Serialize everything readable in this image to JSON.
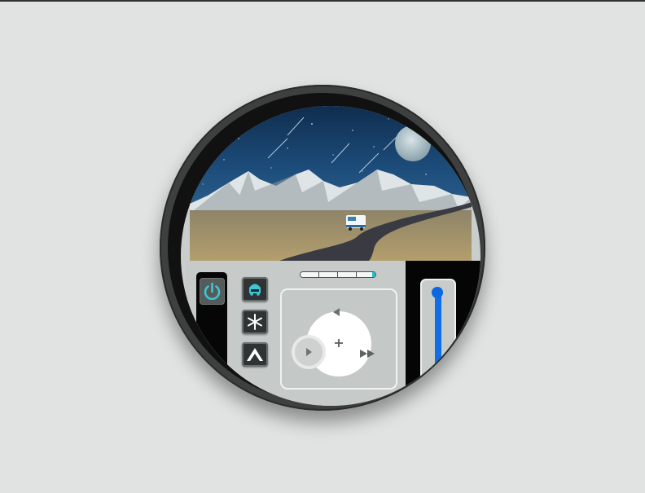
{
  "app": {
    "scene": "rv-on-mountain-road-under-starry-night",
    "colors": {
      "background": "#e1e3e3",
      "bezel": "#3e4040",
      "panel": "#c6cbca",
      "accent_cyan": "#19c1d3",
      "slider_blue": "#0f6ee6",
      "moon": "#b5c5cc"
    }
  },
  "controls": {
    "power": {
      "icon": "power-icon",
      "active": true
    },
    "mode_buttons": [
      {
        "icon": "car-front-icon"
      },
      {
        "icon": "snowflake-icon"
      },
      {
        "icon": "mountain-icon"
      }
    ],
    "progress": {
      "percent": 100,
      "segments": 4
    },
    "dpad": {
      "icons": [
        "rewind-icon",
        "play-icon",
        "fast-forward-icon",
        "crosshair-icon"
      ]
    },
    "slider": {
      "level": 1.0
    }
  }
}
